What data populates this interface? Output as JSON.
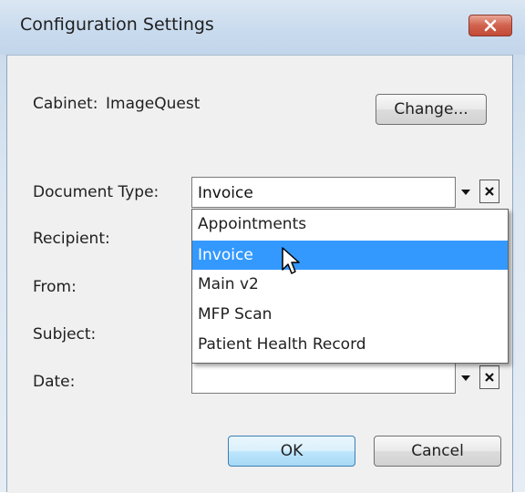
{
  "window": {
    "title": "Configuration Settings",
    "close_symbol": "✕"
  },
  "cabinet": {
    "label": "Cabinet:",
    "value": "ImageQuest",
    "change_button": "Change..."
  },
  "fields": {
    "document_type_label": "Document Type:",
    "document_type_value": "Invoice",
    "recipient_label": "Recipient:",
    "from_label": "From:",
    "subject_label": "Subject:",
    "date_label": "Date:",
    "date_value": ""
  },
  "dropdown": {
    "items": [
      {
        "label": "Appointments",
        "selected": false
      },
      {
        "label": "Invoice",
        "selected": true
      },
      {
        "label": "Main v2",
        "selected": false
      },
      {
        "label": "MFP Scan",
        "selected": false
      },
      {
        "label": "Patient Health Record",
        "selected": false
      }
    ]
  },
  "buttons": {
    "ok": "OK",
    "cancel": "Cancel"
  },
  "icons": {
    "combo_arrow": "chevron-down-icon",
    "clear": "close-icon",
    "cursor": "mouse-pointer-icon"
  },
  "colors": {
    "selection": "#3399ff",
    "close_button": "#c24a35"
  }
}
